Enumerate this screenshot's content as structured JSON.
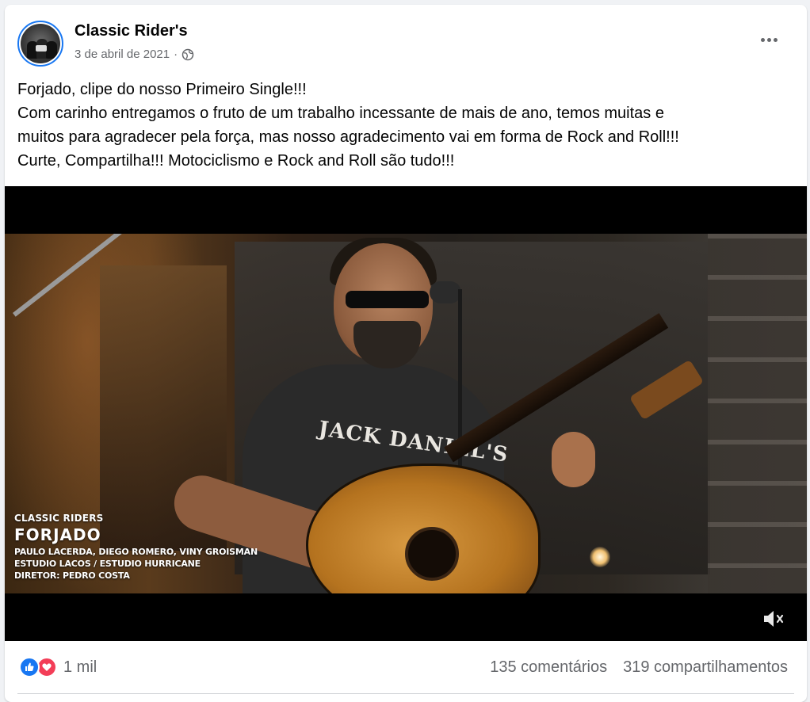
{
  "post": {
    "page_name": "Classic Rider's",
    "date": "3 de abril de 2021",
    "separator": "·",
    "privacy_icon": "globe-icon",
    "more_icon": "more-options-icon",
    "text_lines": [
      "Forjado, clipe do nosso Primeiro Single!!!",
      "Com carinho entregamos o fruto de um trabalho incessante de mais de ano, temos muitas e",
      "muitos para agradecer pela força, mas nosso agradecimento vai em forma de Rock and Roll!!!",
      "Curte, Compartilha!!! Motociclismo e Rock and Roll são tudo!!!"
    ]
  },
  "video": {
    "shirt_text": "JACK DANIEL'S",
    "credits": {
      "band": "CLASSIC RIDERS",
      "song": "FORJADO",
      "lines": [
        "PAULO LACERDA, DIEGO ROMERO, VINY GROISMAN",
        "ESTUDIO LACOS / ESTUDIO HURRICANE",
        "DIRETOR: PEDRO COSTA"
      ]
    },
    "mute_icon": "speaker-muted-icon"
  },
  "footer": {
    "reactions": [
      "like-icon",
      "love-icon"
    ],
    "reaction_count": "1 mil",
    "comments": "135 comentários",
    "shares": "319 compartilhamentos"
  },
  "colors": {
    "accent": "#1877f2",
    "love": "#f33e58",
    "secondary_text": "#65676b",
    "primary_text": "#050505",
    "background": "#f0f2f5"
  }
}
